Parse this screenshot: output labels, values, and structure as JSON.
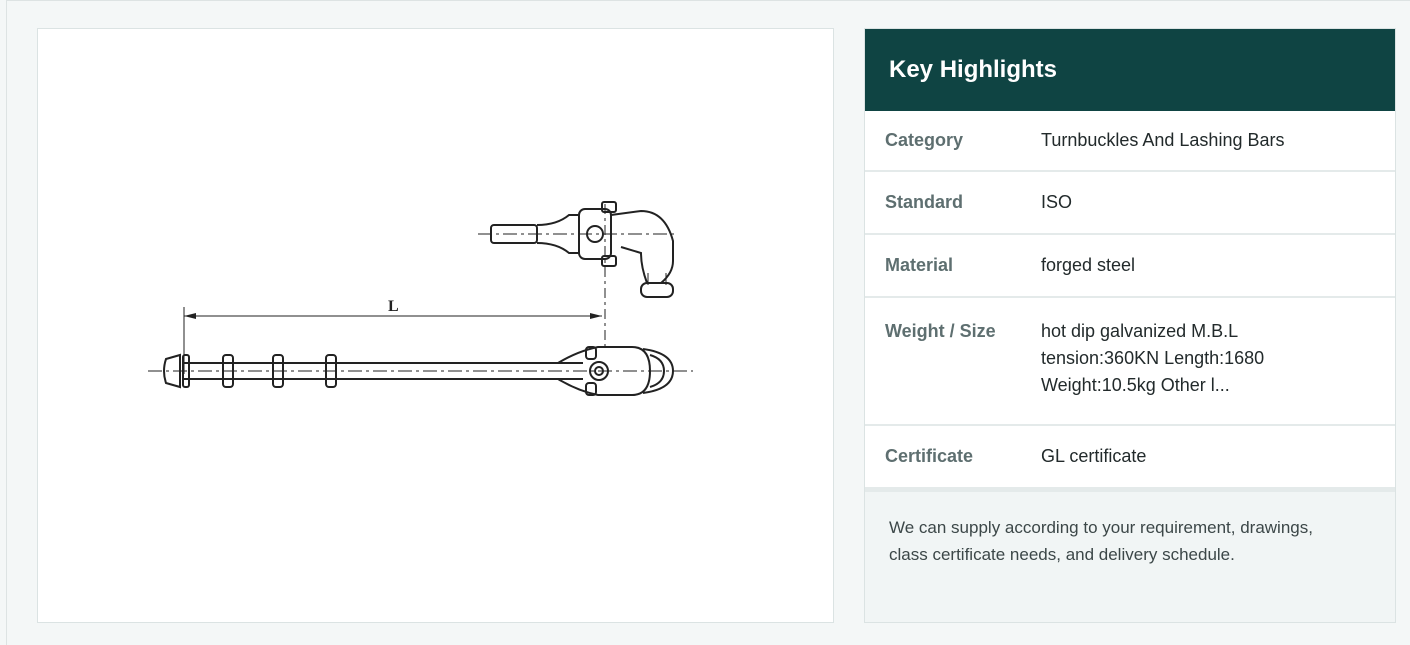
{
  "product_image": {
    "dimension_label": "L"
  },
  "highlights": {
    "title": "Key Highlights",
    "rows": [
      {
        "label": "Category",
        "value": "Turnbuckles And Lashing Bars"
      },
      {
        "label": "Standard",
        "value": "ISO"
      },
      {
        "label": "Material",
        "value": "forged steel"
      },
      {
        "label": "Weight / Size",
        "value": "hot dip galvanized M.B.L tension:360KN Length:1680 Weight:10.5kg Other l..."
      },
      {
        "label": "Certificate",
        "value": "GL certificate"
      }
    ],
    "note": "We can supply according to your requirement, drawings, class certificate needs, and delivery schedule."
  },
  "colors": {
    "header_bg": "#0f4443",
    "page_bg": "#f4f7f7"
  }
}
